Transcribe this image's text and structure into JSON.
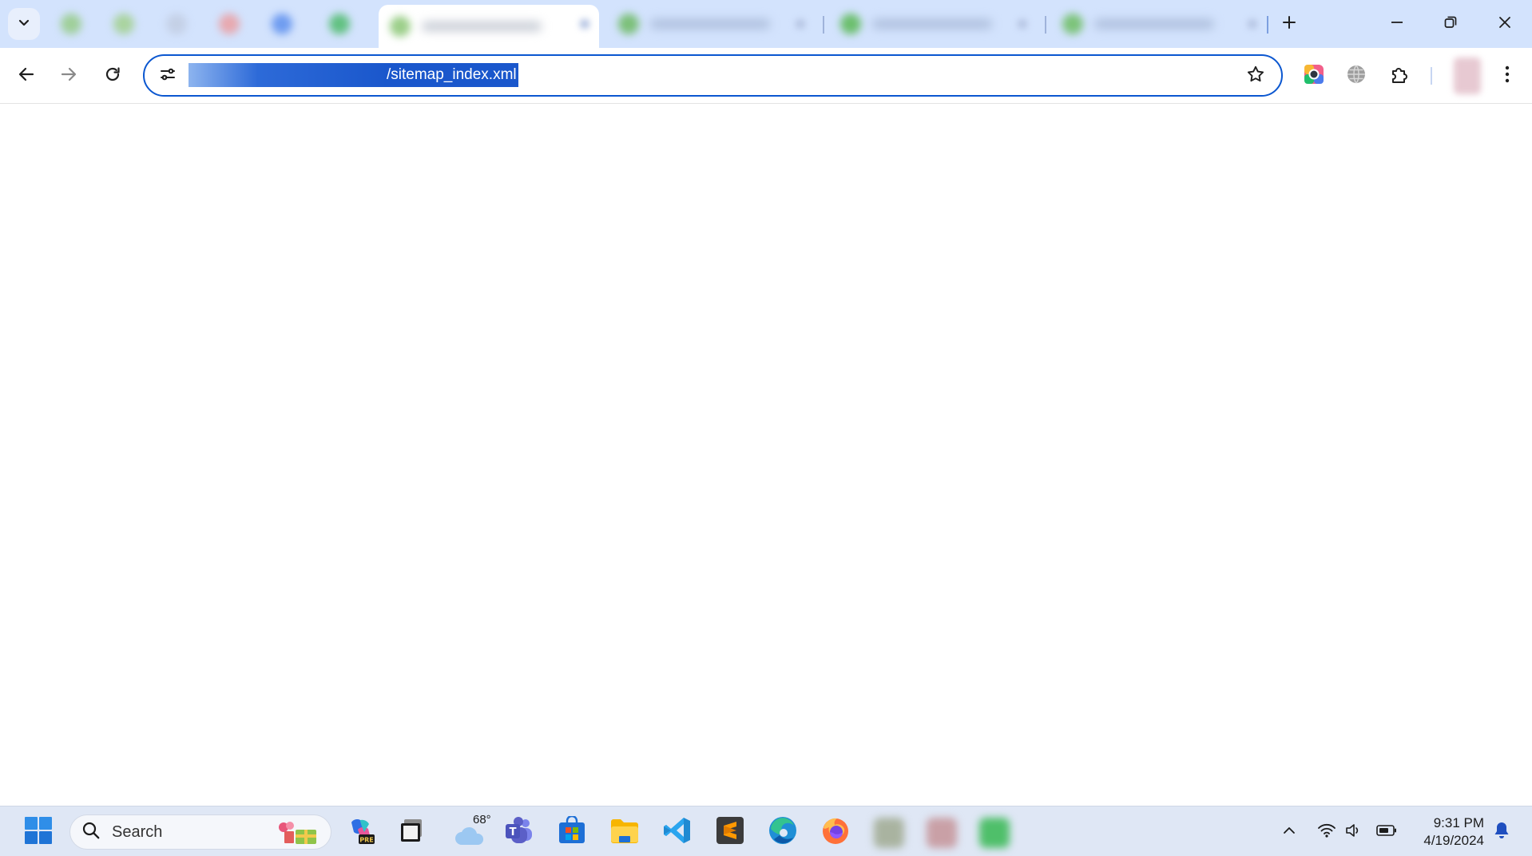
{
  "browser": {
    "tabs": [
      {
        "favicon_color": "#9fcf9a",
        "active": false
      },
      {
        "favicon_color": "#a9d39f",
        "active": false
      },
      {
        "favicon_color": "#c4d0e6",
        "active": false
      },
      {
        "favicon_color": "#e7a9b0",
        "active": false
      },
      {
        "favicon_color": "#6f9cf0",
        "active": false
      },
      {
        "favicon_color": "#62c182",
        "active": false
      },
      {
        "favicon_color": "#9ccf8a",
        "active": true
      },
      {
        "favicon_color": "#7cc07a",
        "active": false
      },
      {
        "favicon_color": "#6cbf6e",
        "active": false
      },
      {
        "favicon_color": "#7cc37a",
        "active": false
      }
    ],
    "address_bar": {
      "url_visible": "/sitemap_index.xml",
      "selected": true
    }
  },
  "taskbar": {
    "search": {
      "label": "Search"
    },
    "weather": {
      "temperature": "68°"
    },
    "apps": [
      "start-icon",
      "copilot-icon",
      "terminal-icon",
      "weather-icon",
      "teams-icon",
      "store-icon",
      "file-explorer-icon",
      "vscode-icon",
      "sublime-text-icon",
      "edge-icon",
      "firefox-icon"
    ],
    "clock": {
      "time": "9:31 PM",
      "date": "4/19/2024"
    }
  },
  "colors": {
    "accent": "#0b57d0",
    "tabstrip_bg": "#d3e3fd",
    "taskbar_bg": "#dfe7f5",
    "url_selection": "#1a57cc"
  }
}
